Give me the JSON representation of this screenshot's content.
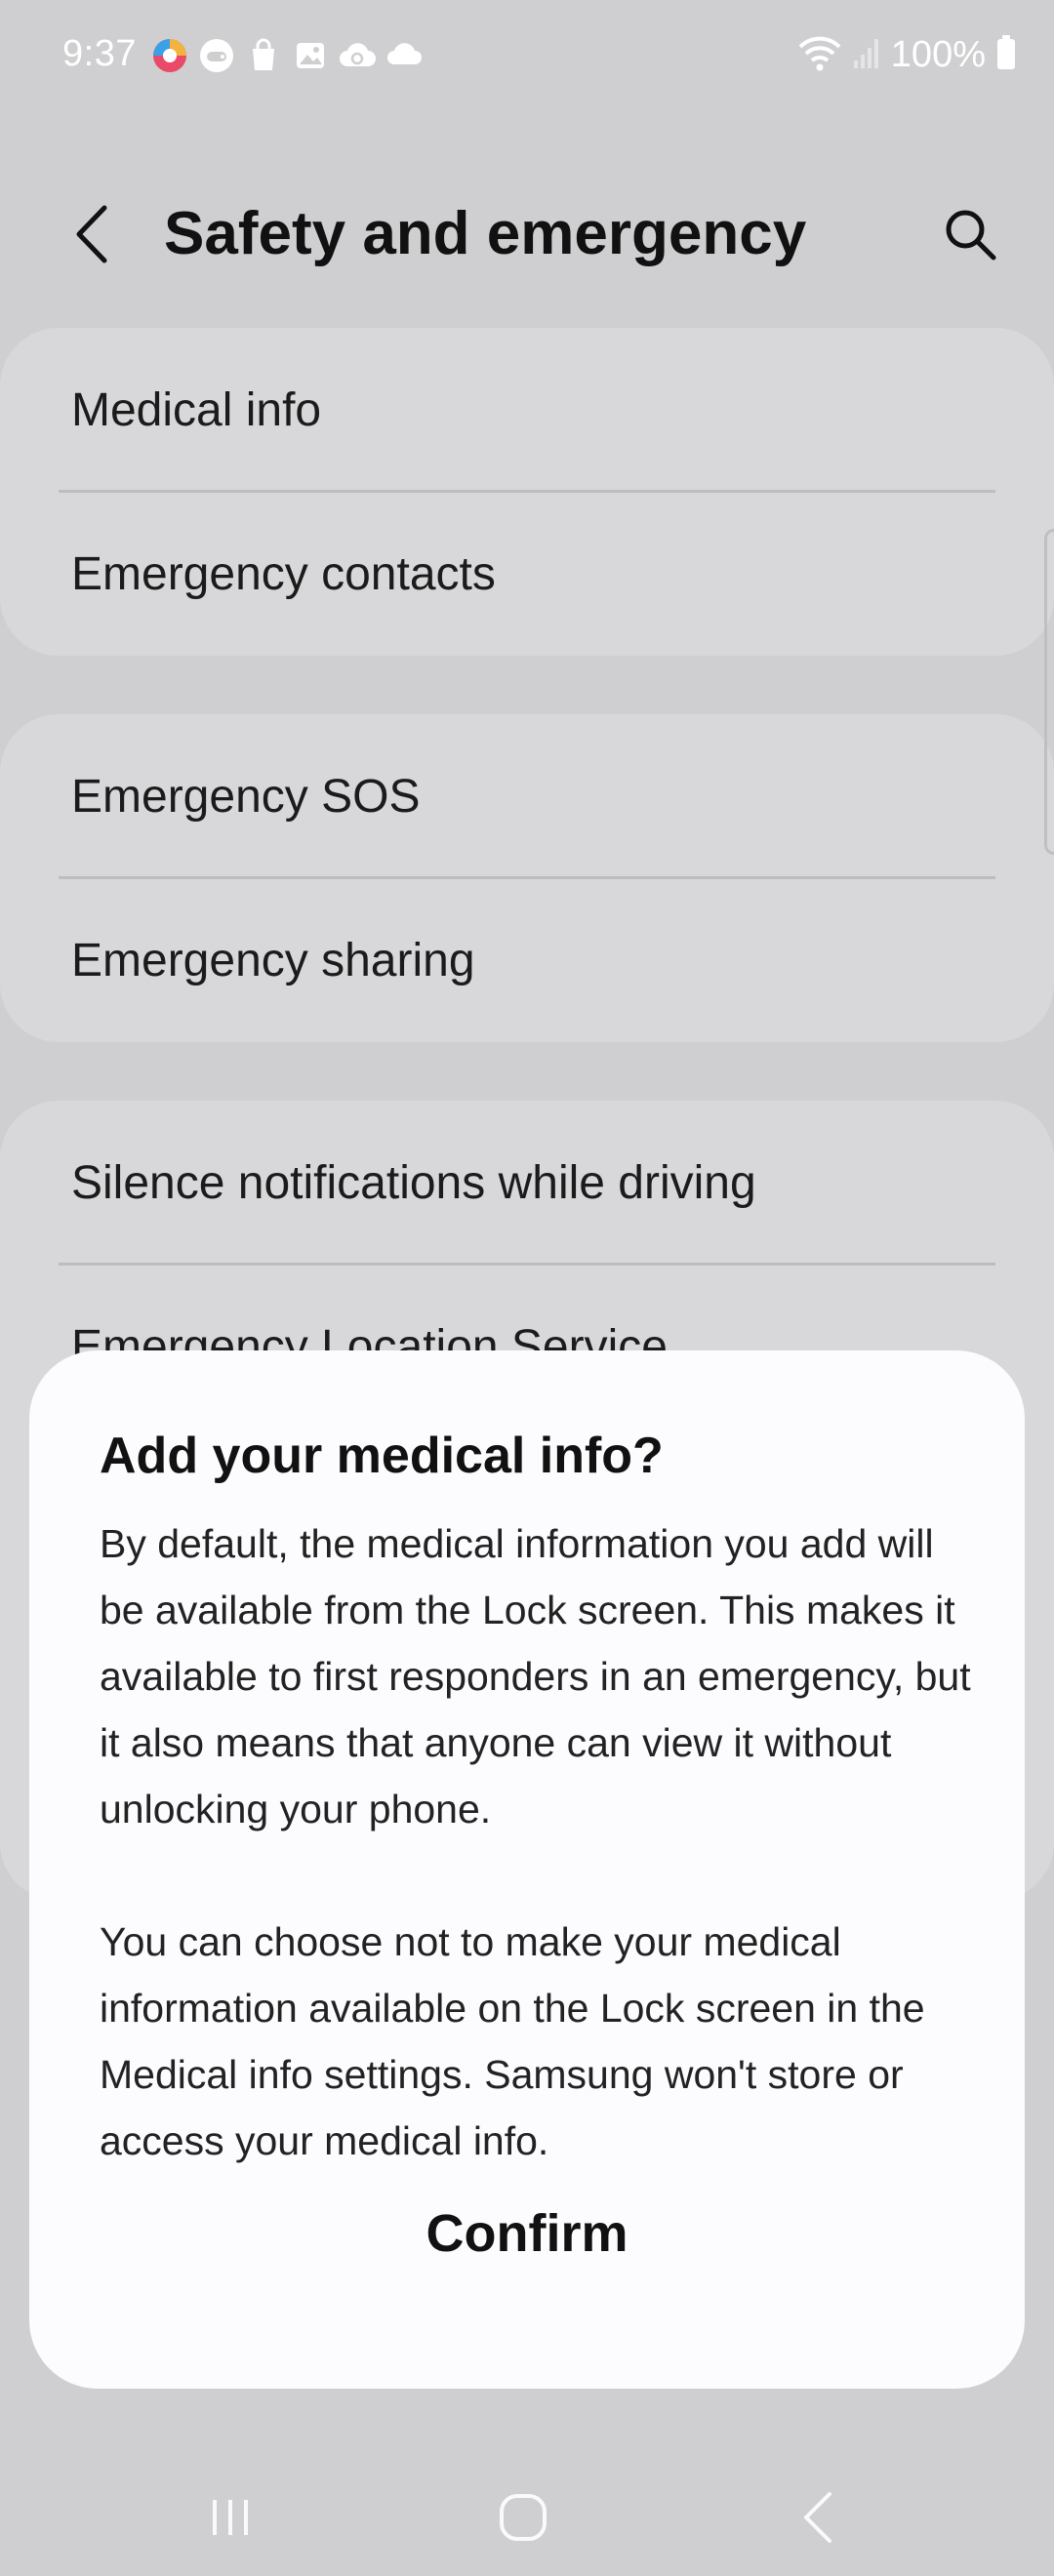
{
  "status_bar": {
    "time": "9:37",
    "battery": "100%",
    "left_icons": [
      "app-colorful-icon",
      "game-icon",
      "bag-icon",
      "gallery-icon",
      "cloud-sync-icon",
      "cloud-icon"
    ],
    "right_icons": [
      "wifi-icon",
      "signal-icon",
      "battery-icon"
    ]
  },
  "app_bar": {
    "title": "Safety and emergency",
    "back_icon": "chevron-left-icon",
    "search_icon": "search-icon"
  },
  "groups": [
    {
      "items": [
        "Medical info",
        "Emergency contacts"
      ]
    },
    {
      "items": [
        "Emergency SOS",
        "Emergency sharing"
      ]
    },
    {
      "items": [
        "Silence notifications while driving",
        "Emergency Location Service"
      ]
    }
  ],
  "dialog": {
    "title": "Add your medical info?",
    "paragraph_1": "By default, the medical information you add will be available from the Lock screen. This makes it available to first responders in an emergency, but it also means that anyone can view it without unlocking your phone.",
    "paragraph_2": "You can choose not to make your medical information available on the Lock screen in the Medical info settings. Samsung won't store or access your medical info.",
    "confirm_label": "Confirm"
  },
  "nav_bar": {
    "recents_icon": "recents-icon",
    "home_icon": "home-icon",
    "back_icon": "back-icon"
  },
  "colors": {
    "background": "#cfcfd1",
    "card": "#d8d8da",
    "dialog": "#fcfcfe",
    "text": "#111111"
  }
}
